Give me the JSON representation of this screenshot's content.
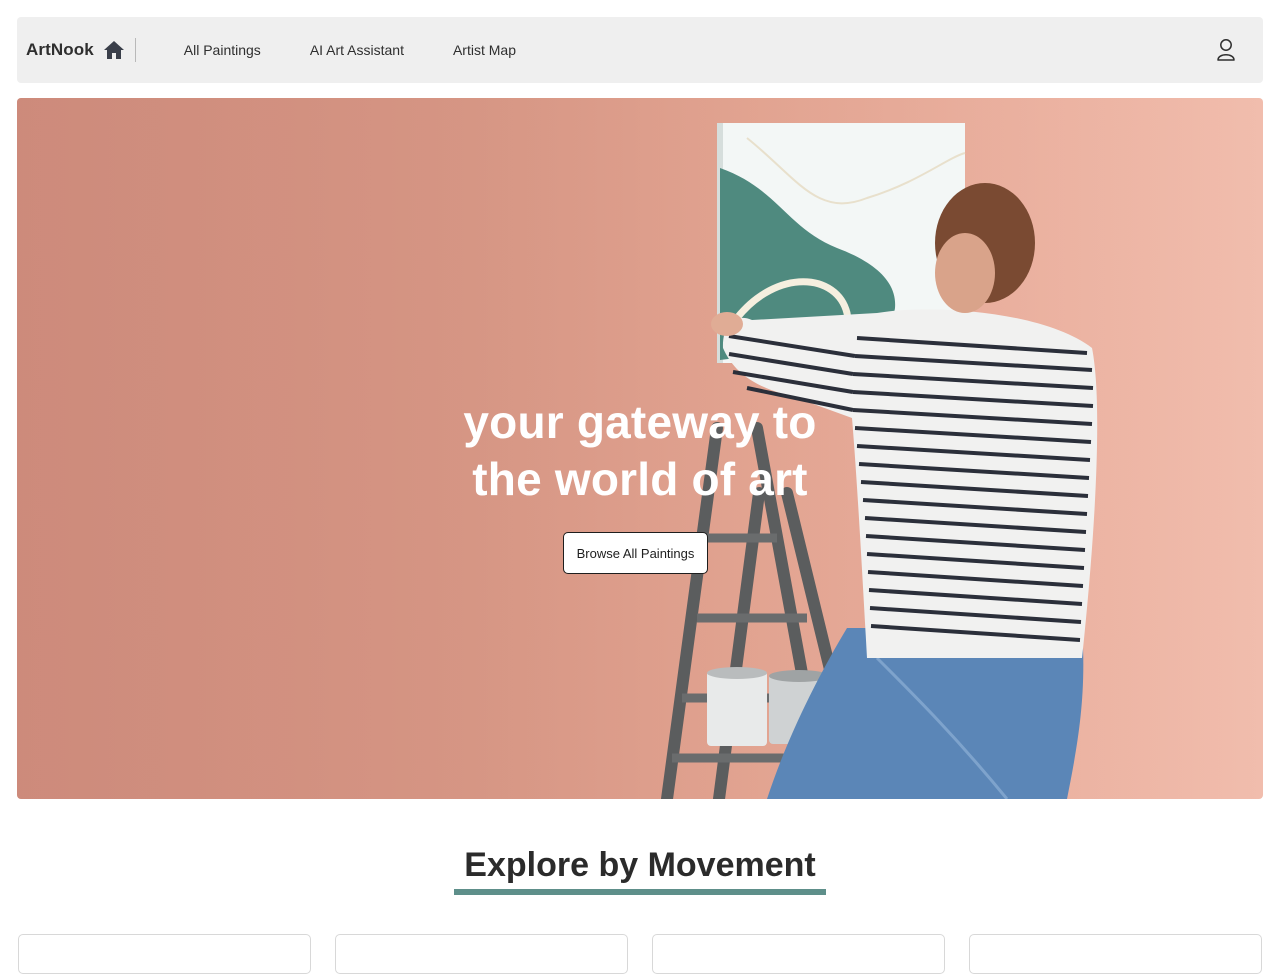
{
  "navbar": {
    "brand": "ArtNook",
    "brand_icon": "home-icon",
    "links": [
      {
        "label": "All Paintings"
      },
      {
        "label": "AI Art Assistant"
      },
      {
        "label": "Artist Map"
      }
    ],
    "account_icon": "user-icon"
  },
  "hero": {
    "title_line1": "your gateway to",
    "title_line2": "the world of art",
    "cta_label": "Browse All Paintings"
  },
  "movements": {
    "title": "Explore by Movement",
    "accent_color": "#5e8f8a",
    "cards": [
      {},
      {},
      {},
      {}
    ]
  }
}
